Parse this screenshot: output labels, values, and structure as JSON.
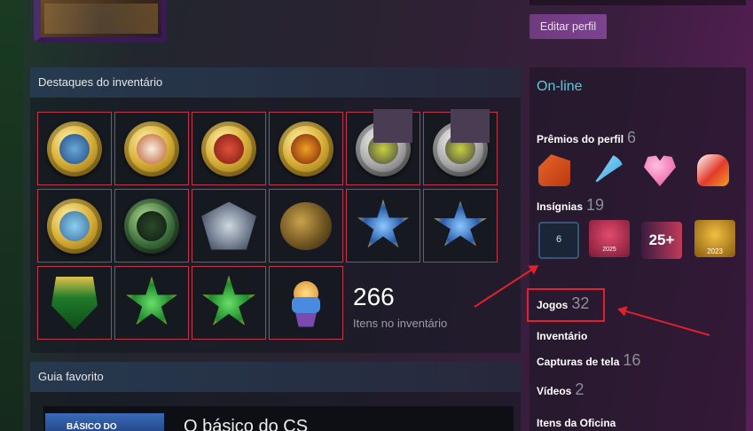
{
  "edit_profile_label": "Editar perfil",
  "inventory": {
    "header": "Destaques do inventário",
    "count": "266",
    "count_label": "Itens no inventário",
    "items": [
      {
        "name": "operation-coin-blue",
        "kind": "coin"
      },
      {
        "name": "operation-coin-gold-lighthouse",
        "kind": "coin"
      },
      {
        "name": "operation-coin-gold-red",
        "kind": "coin"
      },
      {
        "name": "operation-coin-gold-city",
        "kind": "coin"
      },
      {
        "name": "operation-coin-silver-1",
        "kind": "coin"
      },
      {
        "name": "operation-coin-silver-2",
        "kind": "coin"
      },
      {
        "name": "operation-coin-gold-blue-2",
        "kind": "coin"
      },
      {
        "name": "operation-hydra-coin",
        "kind": "coin"
      },
      {
        "name": "winged-pin",
        "kind": "pin"
      },
      {
        "name": "snake-pin",
        "kind": "pin"
      },
      {
        "name": "service-medal-star-blue",
        "kind": "medal"
      },
      {
        "name": "service-medal-wings-blue",
        "kind": "medal"
      },
      {
        "name": "service-medal-shield-green",
        "kind": "medal"
      },
      {
        "name": "service-medal-star-green",
        "kind": "medal"
      },
      {
        "name": "service-medal-star-green-gold",
        "kind": "medal"
      },
      {
        "name": "cupcake-pin",
        "kind": "pin"
      }
    ]
  },
  "guide": {
    "header": "Guia favorito",
    "thumb_text": "BÁSICO DO",
    "title": "O básico do CS"
  },
  "sidebar": {
    "status": "On-line",
    "awards": {
      "label": "Prêmios do perfil",
      "count": "6"
    },
    "badges": {
      "label": "Insígnias",
      "count": "19"
    },
    "badge_items": [
      {
        "name": "years-of-service-badge",
        "text": "6"
      },
      {
        "name": "steam-replay-2025-badge",
        "text": "2025"
      },
      {
        "name": "level-25-badge",
        "text": "25+"
      },
      {
        "name": "steam-replay-2023-badge",
        "text": "2023"
      }
    ],
    "games": {
      "label": "Jogos",
      "count": "32"
    },
    "inventory_link": "Inventário",
    "screenshots": {
      "label": "Capturas de tela",
      "count": "16"
    },
    "videos": {
      "label": "Vídeos",
      "count": "2"
    },
    "workshop": "Itens da Oficina"
  }
}
